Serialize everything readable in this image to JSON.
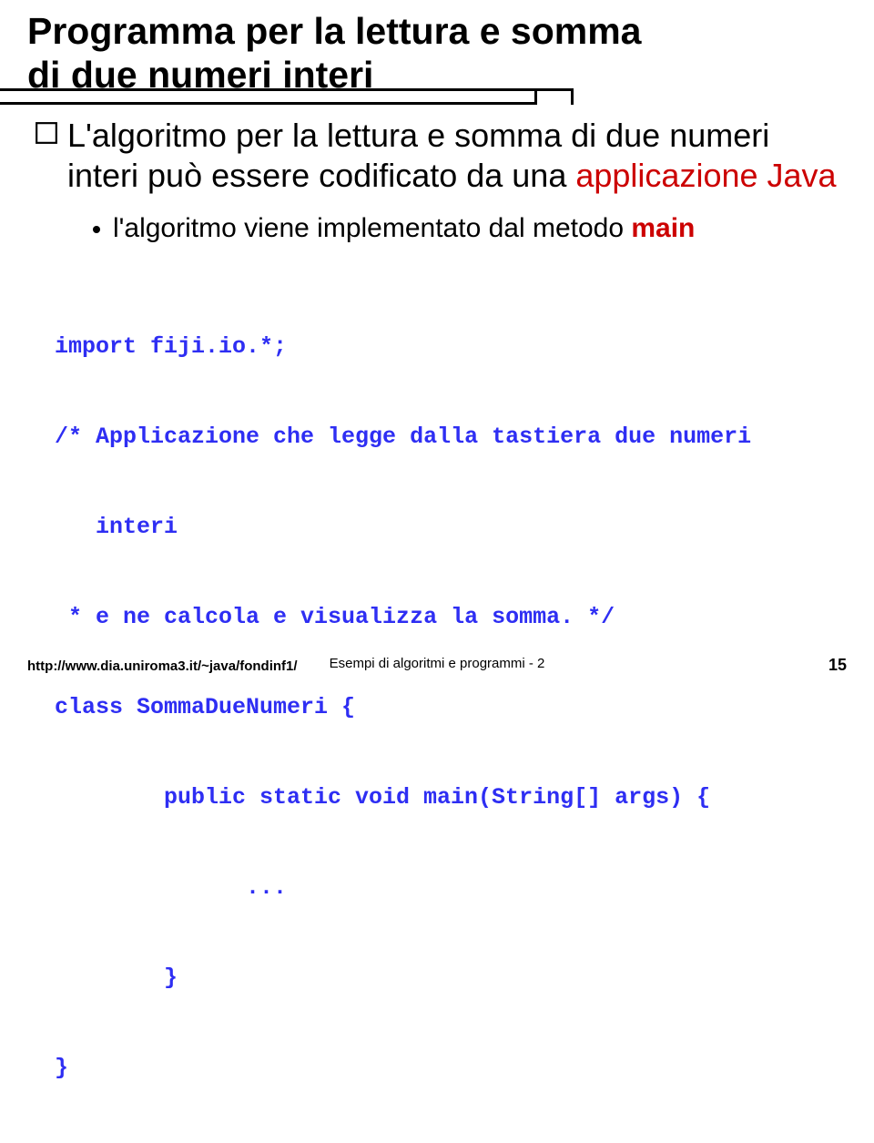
{
  "title": {
    "line1": "Programma per la lettura e somma",
    "line2": "di due numeri interi"
  },
  "bullet": {
    "part1": "L'algoritmo per la lettura e somma di due numeri interi può essere codificato da una ",
    "part2_red": "applicazione Java"
  },
  "subbullet": {
    "part1": "l'algoritmo viene implementato dal metodo ",
    "part2_red": "main"
  },
  "code": {
    "l1": "import fiji.io.*;",
    "l2": "/* Applicazione che legge dalla tastiera due numeri",
    "l3": "   interi",
    "l4": " * e ne calcola e visualizza la somma. */",
    "l5": "class SommaDueNumeri {",
    "l6": "public static void main(String[] args) {",
    "l7": "...",
    "l8": "}",
    "l9": "}"
  },
  "footer": {
    "left": "http://www.dia.uniroma3.it/~java/fondinf1/",
    "center": "Esempi di algoritmi e programmi - 2",
    "right": "15"
  }
}
